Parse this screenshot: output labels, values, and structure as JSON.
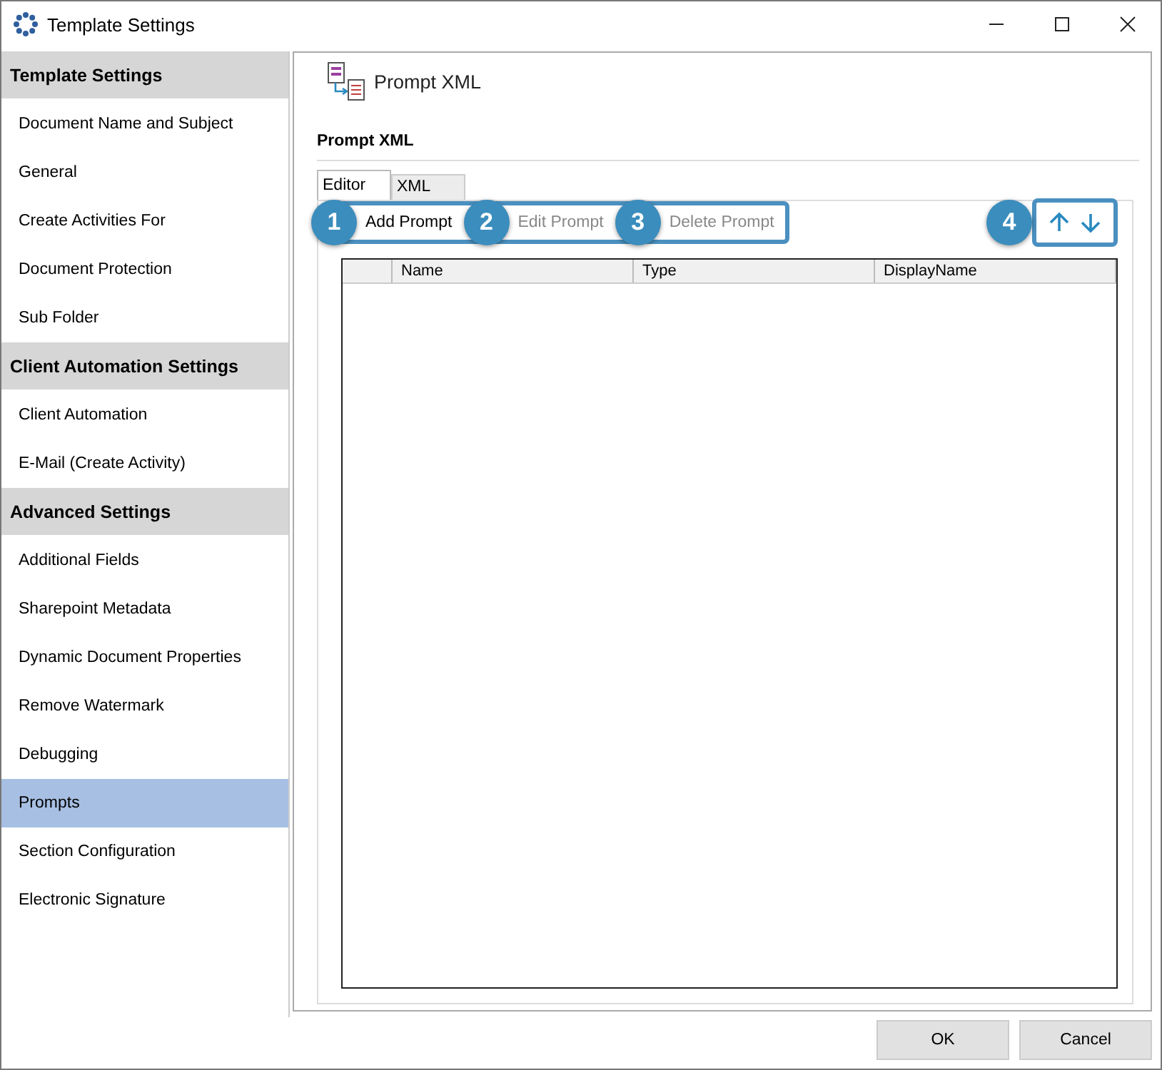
{
  "window": {
    "title": "Template Settings"
  },
  "sidebar": {
    "groups": [
      {
        "title": "Template Settings",
        "items": [
          {
            "label": "Document Name and Subject",
            "selected": false
          },
          {
            "label": "General",
            "selected": false
          },
          {
            "label": "Create Activities For",
            "selected": false
          },
          {
            "label": "Document Protection",
            "selected": false
          },
          {
            "label": "Sub Folder",
            "selected": false
          }
        ]
      },
      {
        "title": "Client Automation Settings",
        "items": [
          {
            "label": "Client Automation",
            "selected": false
          },
          {
            "label": "E-Mail (Create Activity)",
            "selected": false
          }
        ]
      },
      {
        "title": "Advanced Settings",
        "items": [
          {
            "label": "Additional Fields",
            "selected": false
          },
          {
            "label": "Sharepoint Metadata",
            "selected": false
          },
          {
            "label": "Dynamic Document Properties",
            "selected": false
          },
          {
            "label": "Remove Watermark",
            "selected": false
          },
          {
            "label": "Debugging",
            "selected": false
          },
          {
            "label": "Prompts",
            "selected": true
          },
          {
            "label": "Section Configuration",
            "selected": false
          },
          {
            "label": "Electronic Signature",
            "selected": false
          }
        ]
      }
    ]
  },
  "panel": {
    "title": "Prompt XML",
    "section": "Prompt XML",
    "tabs": [
      {
        "label": "Editor",
        "selected": true
      },
      {
        "label": "XML",
        "selected": false
      }
    ],
    "toolbar": [
      {
        "callout": "1",
        "label": "Add Prompt",
        "disabled": false
      },
      {
        "callout": "2",
        "label": "Edit Prompt",
        "disabled": true
      },
      {
        "callout": "3",
        "label": "Delete Prompt",
        "disabled": true
      }
    ],
    "move_callout": "4",
    "table": {
      "columns": [
        "Name",
        "Type",
        "DisplayName"
      ]
    }
  },
  "buttons": [
    "OK",
    "Cancel"
  ]
}
